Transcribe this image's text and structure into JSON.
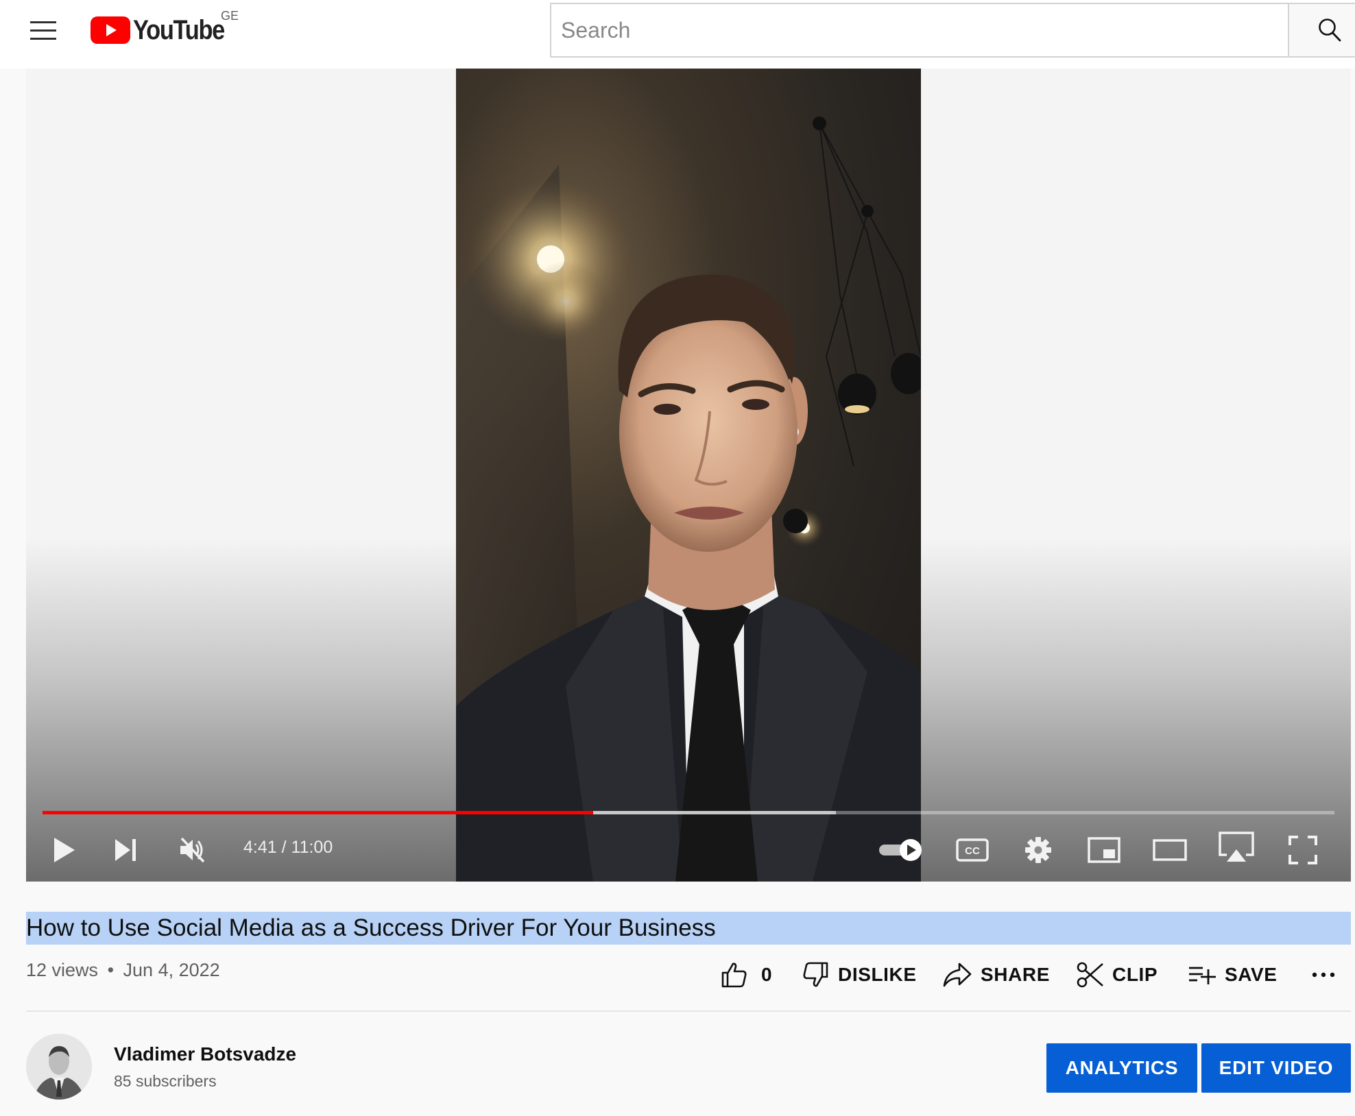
{
  "header": {
    "logo_text": "YouTube",
    "country_code": "GE",
    "search_placeholder": "Search",
    "search_value": ""
  },
  "player": {
    "current_time": "4:41",
    "duration": "11:00",
    "time_display": "4:41 / 11:00",
    "played_fraction": 0.426,
    "buffered_fraction": 0.614,
    "muted": true,
    "autoplay_on": true,
    "progress_color": "#ff0000"
  },
  "video": {
    "title": "How to Use Social Media as a Success Driver For Your Business",
    "views": "12 views",
    "separator": "•",
    "date": "Jun 4, 2022"
  },
  "actions": {
    "like_count": "0",
    "dislike_label": "DISLIKE",
    "share_label": "SHARE",
    "clip_label": "CLIP",
    "save_label": "SAVE",
    "more_label": "⋯"
  },
  "channel": {
    "name": "Vladimer Botsvadze",
    "subscribers": "85 subscribers"
  },
  "owner_buttons": {
    "analytics_label": "ANALYTICS",
    "edit_video_label": "EDIT VIDEO"
  },
  "colors": {
    "brand_red": "#ff0000",
    "button_blue": "#065fd4",
    "title_highlight": "#b7d2f6"
  }
}
